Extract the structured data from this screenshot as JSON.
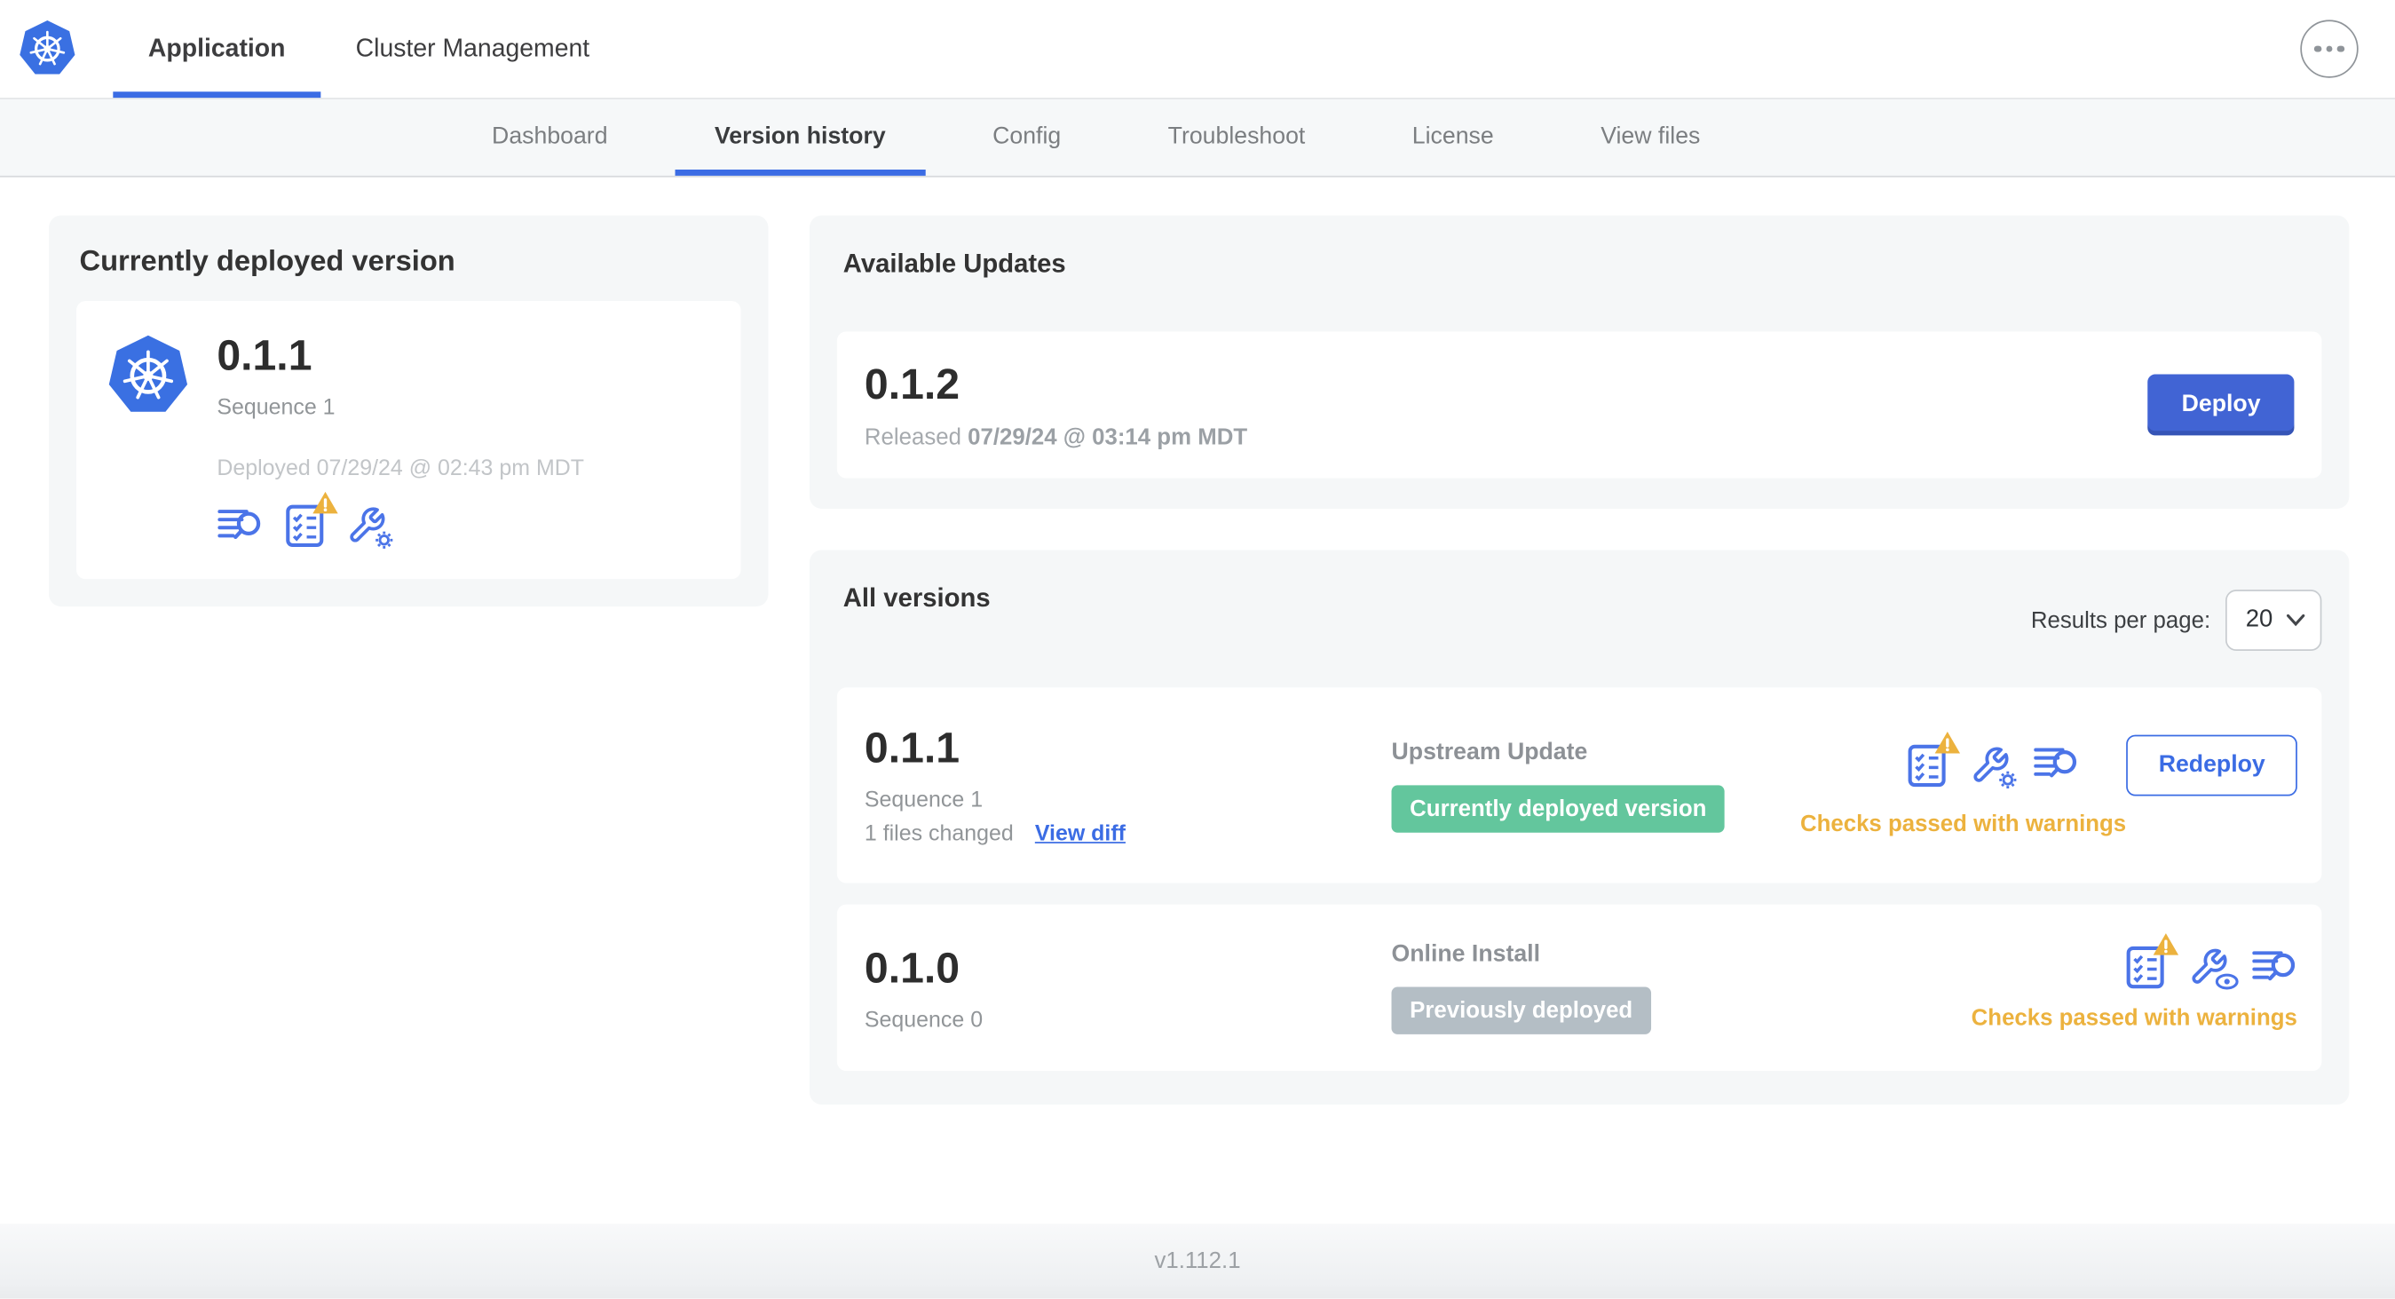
{
  "colors": {
    "accent_blue": "#3b6ce4",
    "icon_blue": "#4b74e8",
    "deploy_button_blue": "#4164d4",
    "warning_yellow": "#ecb23e",
    "badge_green": "#63c69d",
    "badge_gray": "#b4bec5",
    "kubernetes_logo_blue": "#3a70e2"
  },
  "top_nav": {
    "logo_icon": "kubernetes-logo",
    "tabs": [
      {
        "label": "Application",
        "active": true
      },
      {
        "label": "Cluster Management",
        "active": false
      }
    ],
    "overflow_icon": "ellipsis-icon"
  },
  "sub_nav": {
    "tabs": [
      "Dashboard",
      "Version history",
      "Config",
      "Troubleshoot",
      "License",
      "View files"
    ],
    "active": "Version history"
  },
  "currently_deployed": {
    "title": "Currently deployed version",
    "version": "0.1.1",
    "sequence": "Sequence 1",
    "deployed_at": "Deployed 07/29/24 @ 02:43 pm MDT",
    "icons": [
      "diff-icon",
      "preflight-checks-warning-icon",
      "edit-config-icon"
    ]
  },
  "available_updates": {
    "title": "Available Updates",
    "update": {
      "version": "0.1.2",
      "released_label": "Released",
      "released_at": "07/29/24 @ 03:14 pm MDT",
      "deploy_label": "Deploy"
    }
  },
  "all_versions": {
    "title": "All versions",
    "results_per_page": {
      "label": "Results per page:",
      "value": "20"
    },
    "rows": [
      {
        "version": "0.1.1",
        "sequence": "Sequence 1",
        "files_changed": "1 files changed",
        "view_diff": "View diff",
        "source": "Upstream Update",
        "badge": {
          "label": "Currently deployed version",
          "bg": "#63c69d"
        },
        "icons": [
          "preflight-checks-warning-icon",
          "edit-config-icon",
          "diff-icon"
        ],
        "action": "Redeploy",
        "status": "Checks passed with warnings"
      },
      {
        "version": "0.1.0",
        "sequence": "Sequence 0",
        "source": "Online Install",
        "badge": {
          "label": "Previously deployed",
          "bg": "#b4bec5"
        },
        "icons": [
          "preflight-checks-warning-icon",
          "view-config-icon",
          "diff-icon"
        ],
        "status": "Checks passed with warnings"
      }
    ]
  },
  "footer": {
    "app_version": "v1.112.1"
  }
}
